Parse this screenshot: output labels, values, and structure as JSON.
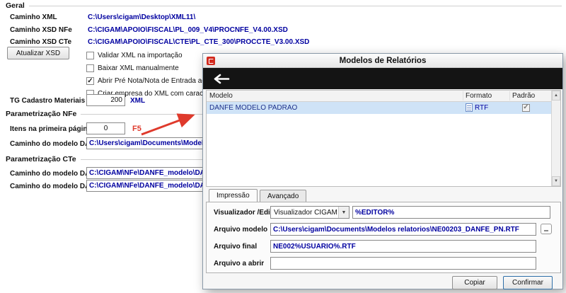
{
  "colors": {
    "value_text": "#0000a0",
    "annotation": "#df3a2c",
    "selected_row_bg": "#cfe3f7",
    "toolbar_bg": "#141414"
  },
  "background_form": {
    "section_geral": "Geral",
    "section_param_nfe": "Parametrização NFe",
    "section_param_cte": "Parametrização CTe",
    "caminho_xml_label": "Caminho XML",
    "caminho_xml_value": "C:\\Users\\cigam\\Desktop\\XML11\\",
    "caminho_xsd_nfe_label": "Caminho XSD NFe",
    "caminho_xsd_nfe_value": "C:\\CIGAM\\APOIO\\FISCAL\\PL_009_V4\\PROCNFE_V4.00.XSD",
    "caminho_xsd_cte_label": "Caminho XSD CTe",
    "caminho_xsd_cte_value": "C:\\CIGAM\\APOIO\\FISCAL\\CTE\\PL_CTE_300\\PROCCTE_V3.00.XSD",
    "atualizar_xsd_button": "Atualizar XSD",
    "checkbox_validar": "Validar XML na importação",
    "checkbox_validar_checked": false,
    "checkbox_baixar": "Baixar XML manualmente",
    "checkbox_baixar_checked": false,
    "checkbox_abrir": "Abrir Pré Nota/Nota de Entrada ao término da",
    "checkbox_abrir_checked": true,
    "checkbox_criar": "Criar empresa do XML com caracteres maiúscul",
    "checkbox_criar_checked": false,
    "tg_cadastro_label": "TG Cadastro Materiais",
    "tg_cadastro_value": "200",
    "tg_cadastro_suffix": "XML",
    "itens_label": "Itens na primeira página",
    "itens_value": "0",
    "itens_annotation": "F5",
    "modelo_danfe_label": "Caminho do modelo DANFE",
    "modelo_danfe_value": "C:\\Users\\cigam\\Documents\\Modelos relatorios\\NE",
    "modelo_dacte_label": "Caminho do modelo DACTE",
    "modelo_dacte_value": "C:\\CIGAM\\NFe\\DANFE_modelo\\DACTE.rtf",
    "modelo_dacte_os_label": "Caminho do modelo DACTE OS",
    "modelo_dacte_os_value": "C:\\CIGAM\\NFe\\DANFE_modelo\\DACTE.rtf"
  },
  "dialog": {
    "title": "Modelos de Relatórios",
    "columns": {
      "modelo": "Modelo",
      "formato": "Formato",
      "padrao": "Padrão"
    },
    "row": {
      "modelo": "DANFE MODELO PADRAO",
      "formato": "RTF",
      "padrao_checked": true
    },
    "tabs": {
      "impressao": "Impressão",
      "avancado": "Avançado"
    },
    "visualizador_label": "Visualizador /Editor",
    "visualizador_select": "Visualizador CIGAM",
    "visualizador_value": "%EDITOR%",
    "arquivo_modelo_label": "Arquivo modelo",
    "arquivo_modelo_value": "C:\\Users\\cigam\\Documents\\Modelos relatorios\\NE00203_DANFE_PN.RTF",
    "arquivo_final_label": "Arquivo final",
    "arquivo_final_value": "NE002%USUARIO%.RTF",
    "arquivo_abrir_label": "Arquivo a abrir",
    "arquivo_abrir_value": "",
    "copiar_button": "Copiar",
    "confirmar_button": "Confirmar"
  }
}
